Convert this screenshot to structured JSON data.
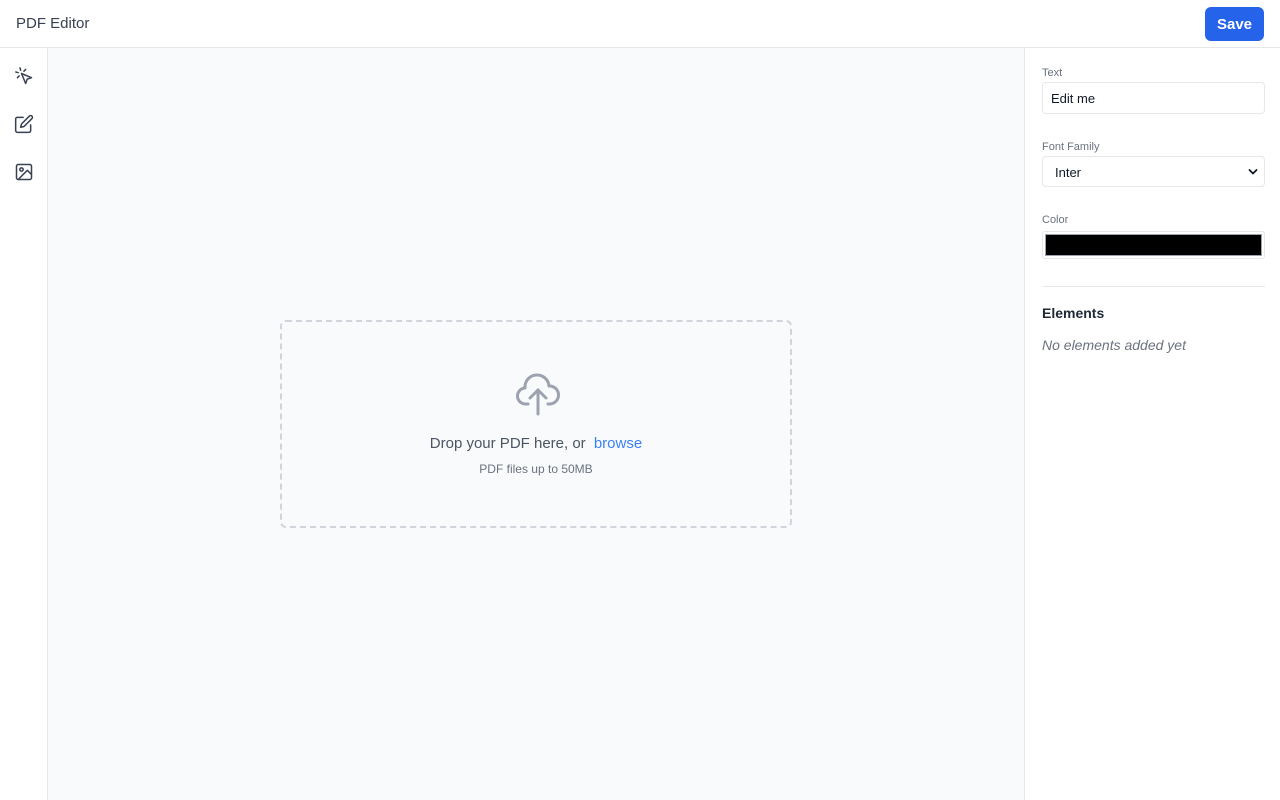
{
  "header": {
    "title": "PDF Editor",
    "save_label": "Save"
  },
  "toolbar": {
    "tools": [
      {
        "name": "select",
        "icon": "cursor-click-icon"
      },
      {
        "name": "text",
        "icon": "edit-icon"
      },
      {
        "name": "image",
        "icon": "image-icon"
      }
    ]
  },
  "dropzone": {
    "icon": "cloud-upload-icon",
    "prompt": "Drop your PDF here, or",
    "browse_label": "browse",
    "hint": "PDF files up to 50MB"
  },
  "properties": {
    "text_label": "Text",
    "text_value": "Edit me",
    "font_family_label": "Font Family",
    "font_family_value": "Inter",
    "color_label": "Color",
    "color_value": "#000000"
  },
  "elements": {
    "title": "Elements",
    "empty_text": "No elements added yet"
  },
  "colors": {
    "accent": "#2563eb",
    "link": "#3b82f6",
    "canvas_bg": "#f9fafb",
    "border": "#e5e7eb"
  }
}
